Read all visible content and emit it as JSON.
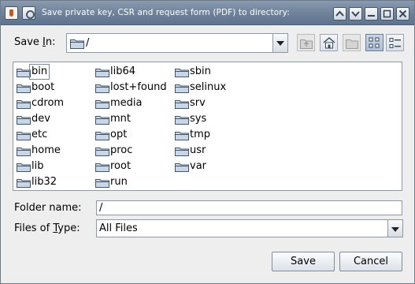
{
  "window": {
    "title": "Save private key, CSR and request form (PDF) to directory:"
  },
  "save_in": {
    "label_pre": "Save ",
    "label_mnemonic": "I",
    "label_post": "n:",
    "value": "/"
  },
  "toolbar": {
    "icons": [
      "up-one-level-icon",
      "home-icon",
      "new-folder-icon",
      "list-view-icon",
      "details-view-icon"
    ]
  },
  "files": {
    "col1": [
      "bin",
      "boot",
      "cdrom",
      "dev",
      "etc",
      "home",
      "lib",
      "lib32"
    ],
    "col2": [
      "lib64",
      "lost+found",
      "media",
      "mnt",
      "opt",
      "proc",
      "root",
      "run"
    ],
    "col3": [
      "sbin",
      "selinux",
      "srv",
      "sys",
      "tmp",
      "usr",
      "var"
    ],
    "selected": "bin"
  },
  "folder_name": {
    "label": "Folder name:",
    "value": "/"
  },
  "file_type": {
    "label_pre": "Files of ",
    "label_mnemonic": "T",
    "label_post": "ype:",
    "value": "All Files"
  },
  "buttons": {
    "save": "Save",
    "cancel": "Cancel"
  },
  "colors": {
    "titlebar": "#6e8199",
    "window_bg": "#eeeeee",
    "folder_fill": "#c9d6e6"
  }
}
